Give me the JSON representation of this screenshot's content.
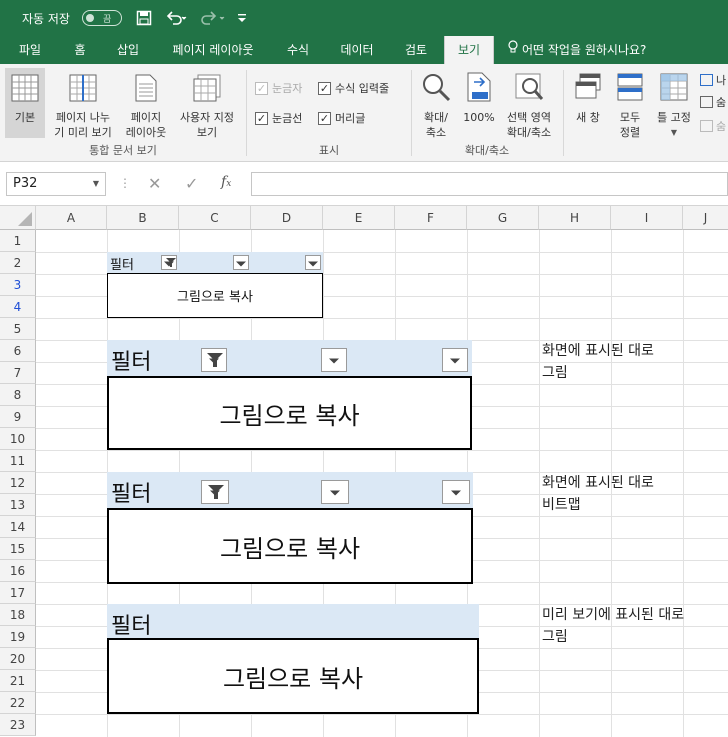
{
  "title_bar": {
    "autosave_label": "자동 저장",
    "autosave_state": "끔",
    "save_icon": "save-icon",
    "undo_icon": "undo-icon",
    "redo_icon": "redo-icon",
    "customize_icon": "customize-icon"
  },
  "tabs": [
    {
      "label": "파일"
    },
    {
      "label": "홈"
    },
    {
      "label": "삽입"
    },
    {
      "label": "페이지 레이아웃"
    },
    {
      "label": "수식"
    },
    {
      "label": "데이터"
    },
    {
      "label": "검토"
    },
    {
      "label": "보기"
    }
  ],
  "active_tab": "보기",
  "tell_me": "어떤 작업을 원하시나요?",
  "ribbon": {
    "workbook_views": {
      "normal": "기본",
      "page_break_line1": "페이지 나누",
      "page_break_line2": "기 미리 보기",
      "page_layout_line1": "페이지",
      "page_layout_line2": "레이아웃",
      "custom_line1": "사용자 지정",
      "custom_line2": "보기",
      "group": "통합 문서 보기"
    },
    "show": {
      "ruler": "눈금자",
      "formula_bar": "수식 입력줄",
      "gridlines": "눈금선",
      "headings": "머리글",
      "group": "표시"
    },
    "zoom": {
      "zoom_line1": "확대/",
      "zoom_line2": "축소",
      "zoom100": "100%",
      "zoom_sel_line1": "선택 영역",
      "zoom_sel_line2": "확대/축소",
      "group": "확대/축소"
    },
    "window": {
      "new_window": "새 창",
      "arrange_line1": "모두",
      "arrange_line2": "정렬",
      "freeze": "틀 고정",
      "split": "나",
      "hide": "숨",
      "unhide": "숨"
    }
  },
  "name_box": "P32",
  "columns": [
    "A",
    "B",
    "C",
    "D",
    "E",
    "F",
    "G",
    "H",
    "I",
    "J"
  ],
  "rows": [
    "1",
    "2",
    "3",
    "4",
    "5",
    "6",
    "7",
    "8",
    "9",
    "10",
    "11",
    "12",
    "13",
    "14",
    "15",
    "16",
    "17",
    "18",
    "19",
    "20",
    "21",
    "22",
    "23"
  ],
  "pictures": [
    {
      "filter": "필터",
      "text": "그림으로 복사"
    },
    {
      "filter": "필터",
      "text": "그림으로 복사"
    },
    {
      "filter": "필터",
      "text": "그림으로 복사"
    },
    {
      "filter": "필터",
      "text": "그림으로 복사"
    }
  ],
  "notes": [
    {
      "line1": "화면에 표시된 대로",
      "line2": "그림"
    },
    {
      "line1": "화면에 표시된 대로",
      "line2": "비트맵"
    },
    {
      "line1": "미리 보기에 표시된 대로",
      "line2": "그림"
    }
  ]
}
